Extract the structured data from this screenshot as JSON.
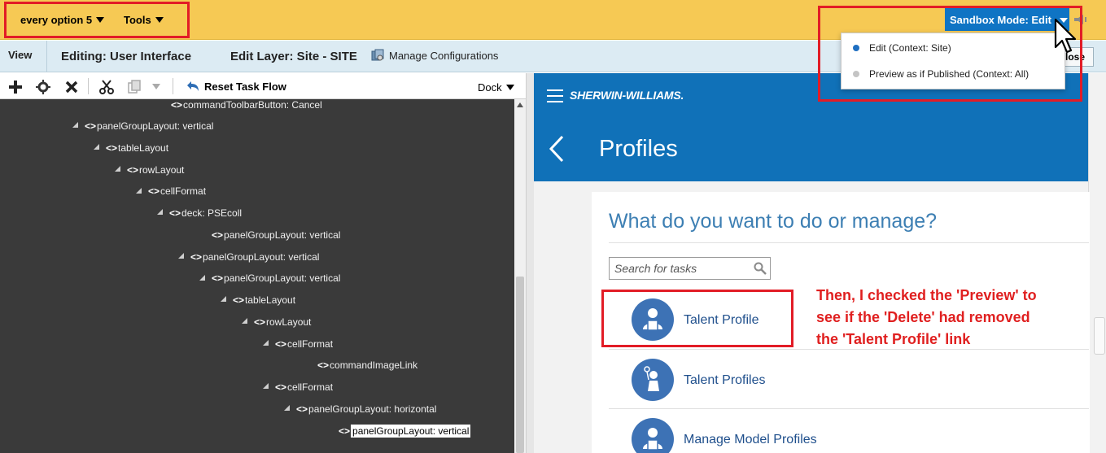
{
  "topbar": {
    "menu_every_option": "every option 5",
    "menu_tools": "Tools",
    "sandbox_mode_label": "Sandbox Mode: Edit",
    "bg_color": "#f6c954",
    "sandbox_color": "#0f74c4"
  },
  "sandbox_dropdown": {
    "options": [
      {
        "label": "Edit (Context: Site)",
        "dot_color": "#1f6fc1",
        "selected": true
      },
      {
        "label": "Preview as if Published (Context: All)",
        "dot_color": "#c4c4c4",
        "selected": false
      }
    ]
  },
  "subbar": {
    "view_label": "View",
    "editing_label": "Editing: User Interface",
    "edit_layer_label": "Edit Layer: Site - SITE",
    "manage_configurations_label": "Manage Configurations",
    "close_label": "lose"
  },
  "left_toolbar": {
    "reset_task_flow_label": "Reset Task Flow",
    "dock_label": "Dock",
    "icons": [
      "add-icon",
      "settings-icon",
      "delete-icon",
      "cut-icon",
      "copy-icon",
      "dropdown-icon",
      "reset-icon"
    ]
  },
  "tree": {
    "nodes": [
      {
        "label": "commandToolbarButton: Cancel",
        "level": 8,
        "expanded": false,
        "partial": true
      },
      {
        "label": "panelGroupLayout: vertical",
        "level": 3,
        "expanded": true
      },
      {
        "label": "tableLayout",
        "level": 4,
        "expanded": true
      },
      {
        "label": "rowLayout",
        "level": 5,
        "expanded": true
      },
      {
        "label": "cellFormat",
        "level": 6,
        "expanded": true
      },
      {
        "label": "deck: PSEcoll",
        "level": 7,
        "expanded": true
      },
      {
        "label": "panelGroupLayout: vertical",
        "level": 9,
        "expanded": false
      },
      {
        "label": "panelGroupLayout: vertical",
        "level": 8,
        "expanded": true
      },
      {
        "label": "panelGroupLayout: vertical",
        "level": 9,
        "expanded": true
      },
      {
        "label": "tableLayout",
        "level": 10,
        "expanded": true
      },
      {
        "label": "rowLayout",
        "level": 11,
        "expanded": true
      },
      {
        "label": "cellFormat",
        "level": 12,
        "expanded": true
      },
      {
        "label": "commandImageLink",
        "level": 14,
        "expanded": false
      },
      {
        "label": "cellFormat",
        "level": 12,
        "expanded": true
      },
      {
        "label": "panelGroupLayout: horizontal",
        "level": 13,
        "expanded": true
      },
      {
        "label": "panelGroupLayout: vertical",
        "level": 15,
        "expanded": false,
        "selected": true
      }
    ]
  },
  "app": {
    "brand": "SHERWIN-WILLIAMS.",
    "page_title": "Profiles",
    "question": "What do you want to do or manage?",
    "search_placeholder": "Search for tasks",
    "header_color": "#1071b8",
    "tasks": [
      {
        "label": "Talent Profile",
        "icon": "person-badge-icon"
      },
      {
        "label": "Talent Profiles",
        "icon": "person-balloon-icon"
      },
      {
        "label": "Manage Model Profiles",
        "icon": "person-badge-icon"
      }
    ]
  },
  "annotation": {
    "lines": [
      "Then, I checked the 'Preview' to",
      "see if the 'Delete' had removed",
      "the 'Talent Profile' link"
    ],
    "color": "#e02020"
  }
}
